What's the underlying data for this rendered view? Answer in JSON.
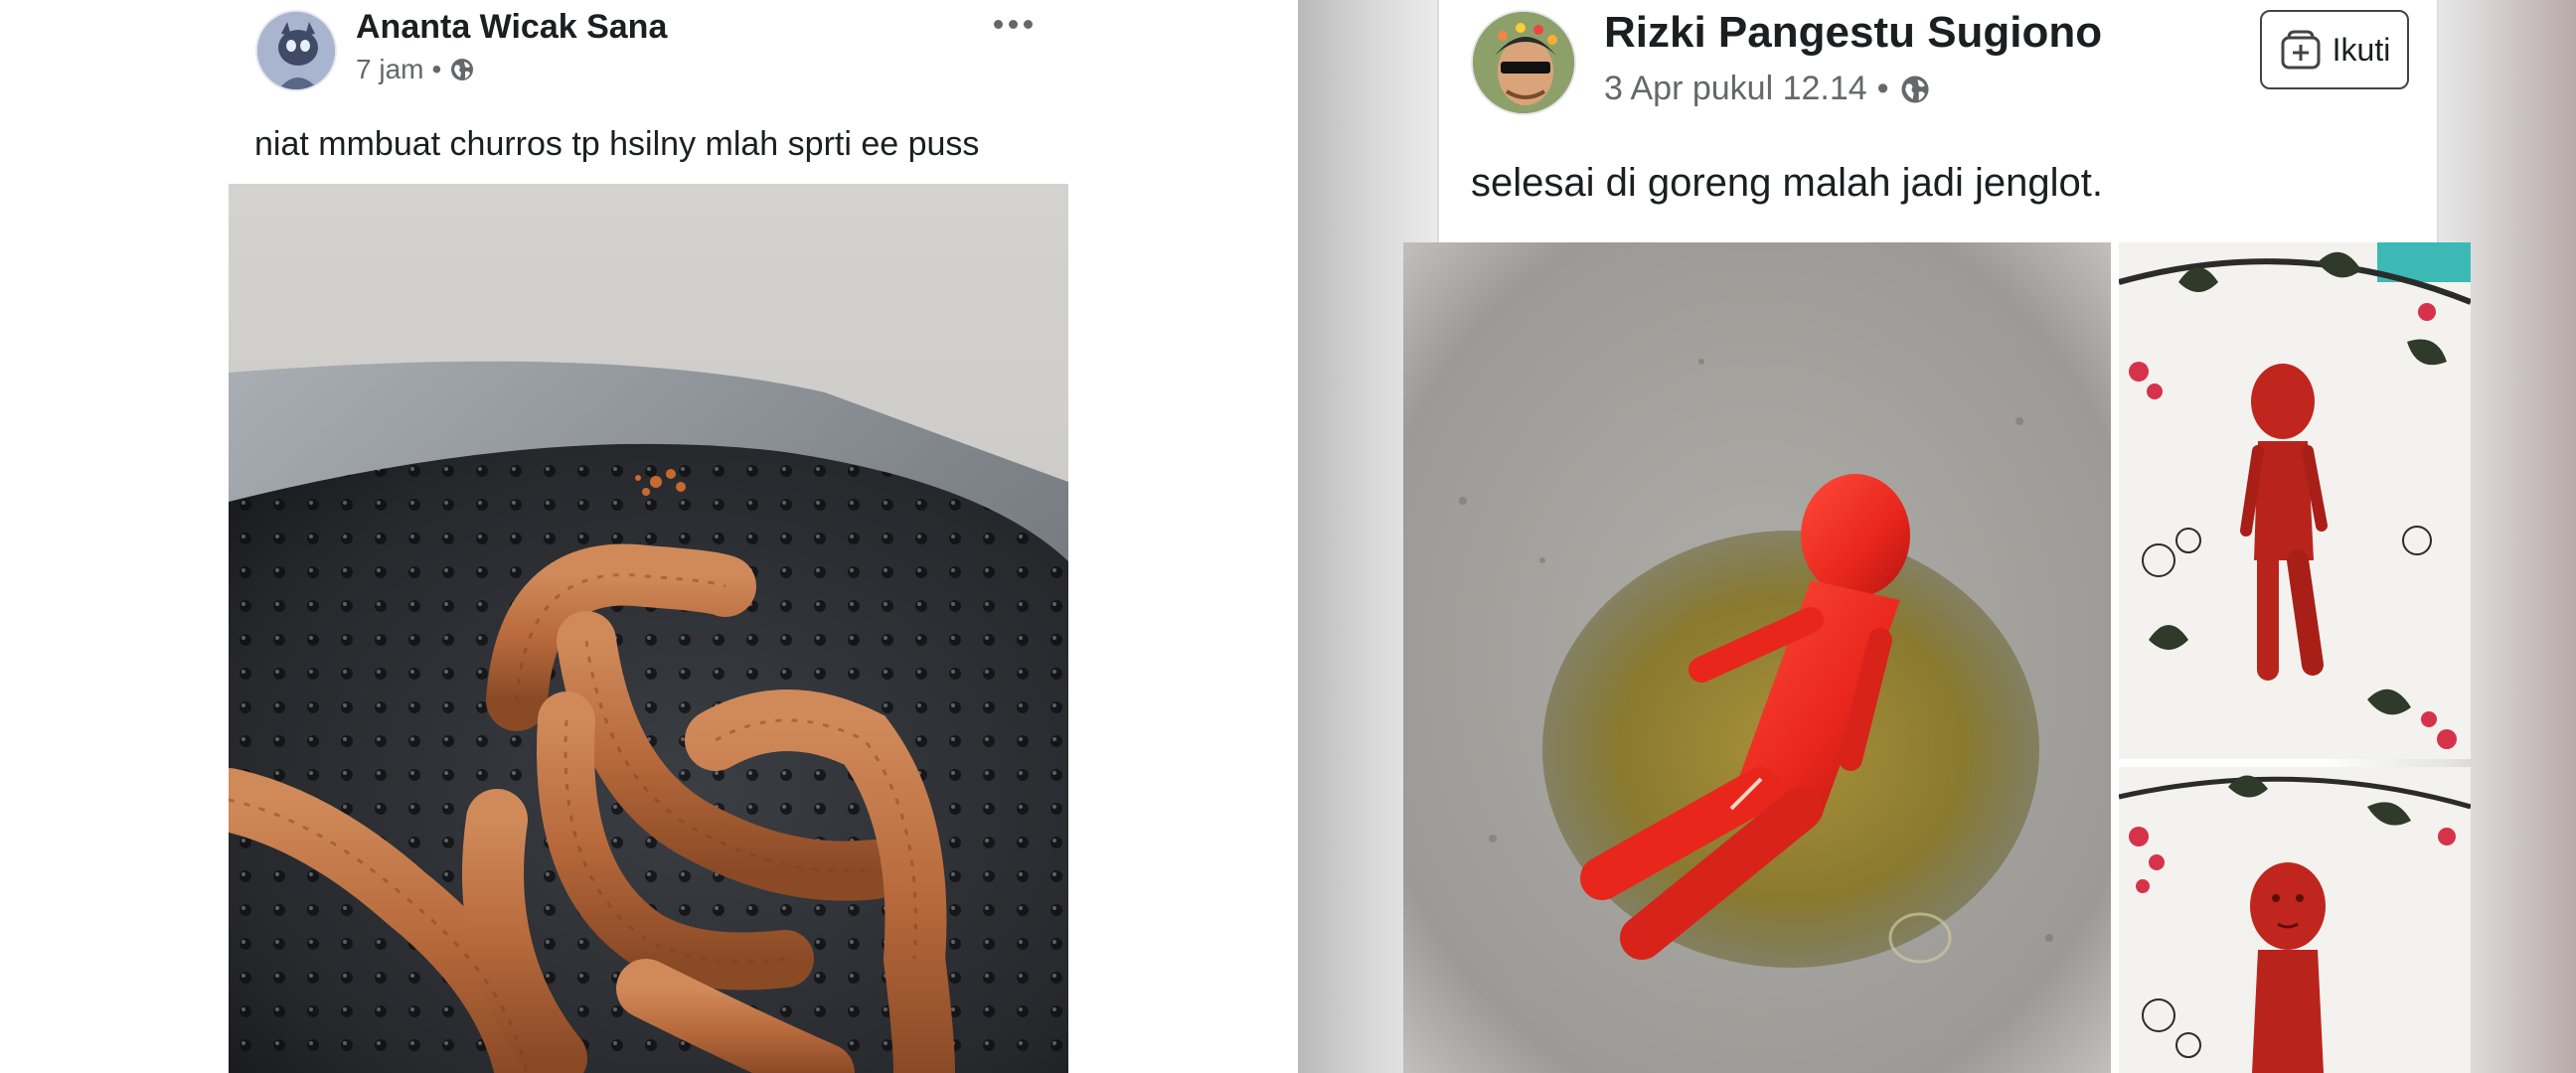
{
  "left_post": {
    "author": "Ananta Wicak Sana",
    "time": "7 jam",
    "separator": "•",
    "privacy_icon": "globe-icon",
    "more_icon": "more-options-icon",
    "caption": "niat mmbuat churros tp hsilny mlah sprti ee puss",
    "photo_icon": "fried-churros-photo"
  },
  "right_post": {
    "author": "Rizki Pangestu Sugiono",
    "time": "3 Apr pukul 12.14",
    "separator": "•",
    "privacy_icon": "globe-icon",
    "follow_label": "Ikuti",
    "follow_icon": "follow-plus-icon",
    "caption": "selesai di goreng malah jadi jenglot.",
    "photos": [
      "fried-sausage-doll-in-oil",
      "sausage-doll-on-plate",
      "sausage-doll-on-plate-closeup"
    ]
  },
  "colors": {
    "text_primary": "#1c1e21",
    "text_secondary": "#65676b",
    "divider": "#dadde1"
  }
}
